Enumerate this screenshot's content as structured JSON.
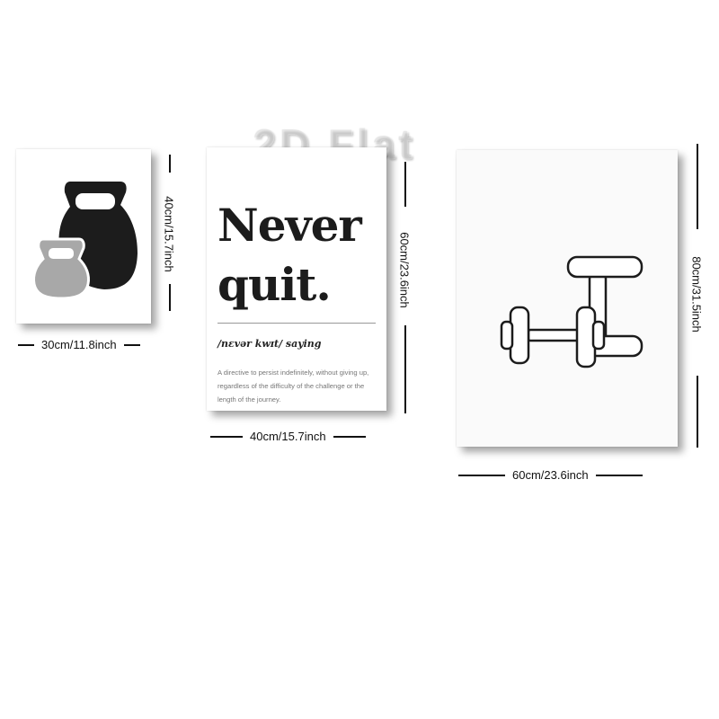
{
  "watermark": "2D Flat",
  "posters": {
    "kettlebell": {
      "width_label": "30cm/11.8inch",
      "height_label": "40cm/15.7inch",
      "icon": "kettlebell-icon",
      "colors": {
        "large": "#1c1c1c",
        "small": "#a8a8a8"
      }
    },
    "never_quit": {
      "headline_line1": "Never",
      "headline_line2": "quit.",
      "pronunciation": "/nɛvər kwɪt/ saying",
      "definition": "A directive to persist indefinitely, without giving up, regardless of the difficulty of the challenge or the length of the journey.",
      "width_label": "40cm/15.7inch",
      "height_label": "60cm/23.6inch"
    },
    "dumbbell": {
      "width_label": "60cm/23.6inch",
      "height_label": "80cm/31.5inch",
      "icon": "dumbbell-icon"
    }
  }
}
